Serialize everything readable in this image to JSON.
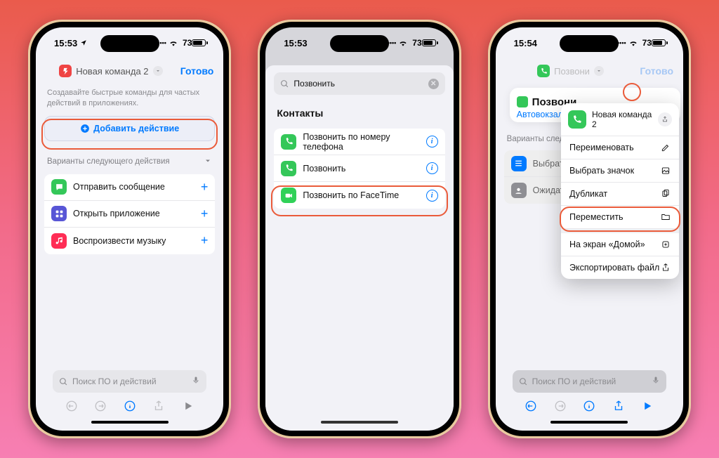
{
  "status": {
    "time1": "15:53",
    "time2": "15:53",
    "time3": "15:54",
    "battery": "73"
  },
  "phone1": {
    "title": "Новая команда 2",
    "done": "Готово",
    "hint": "Создавайте быстрые команды для частых действий в приложениях.",
    "add_label": "Добавить действие",
    "next_label": "Варианты следующего действия",
    "rows": [
      {
        "label": "Отправить сообщение"
      },
      {
        "label": "Открыть приложение"
      },
      {
        "label": "Воспроизвести музыку"
      }
    ],
    "search_placeholder": "Поиск ПО и действий"
  },
  "phone2": {
    "search_value": "Позвонить",
    "contacts_hdr": "Контакты",
    "rows": [
      {
        "label": "Позвонить по номеру телефона"
      },
      {
        "label": "Позвонить"
      },
      {
        "label": "Позвонить по FaceTime"
      }
    ]
  },
  "phone3": {
    "title": "Позвони",
    "done": "Готово",
    "card_title": "Позвони",
    "card_sub": "Автовокзал",
    "next_label": "Варианты следу",
    "rows": [
      {
        "label": "Выбрать из"
      },
      {
        "label": "Ожидать в"
      }
    ],
    "search_placeholder": "Поиск ПО и действий",
    "popover": {
      "title": "Новая команда 2",
      "items": [
        "Переименовать",
        "Выбрать значок",
        "Дубликат",
        "Переместить",
        "На экран «Домой»",
        "Экспортировать файл"
      ]
    }
  }
}
